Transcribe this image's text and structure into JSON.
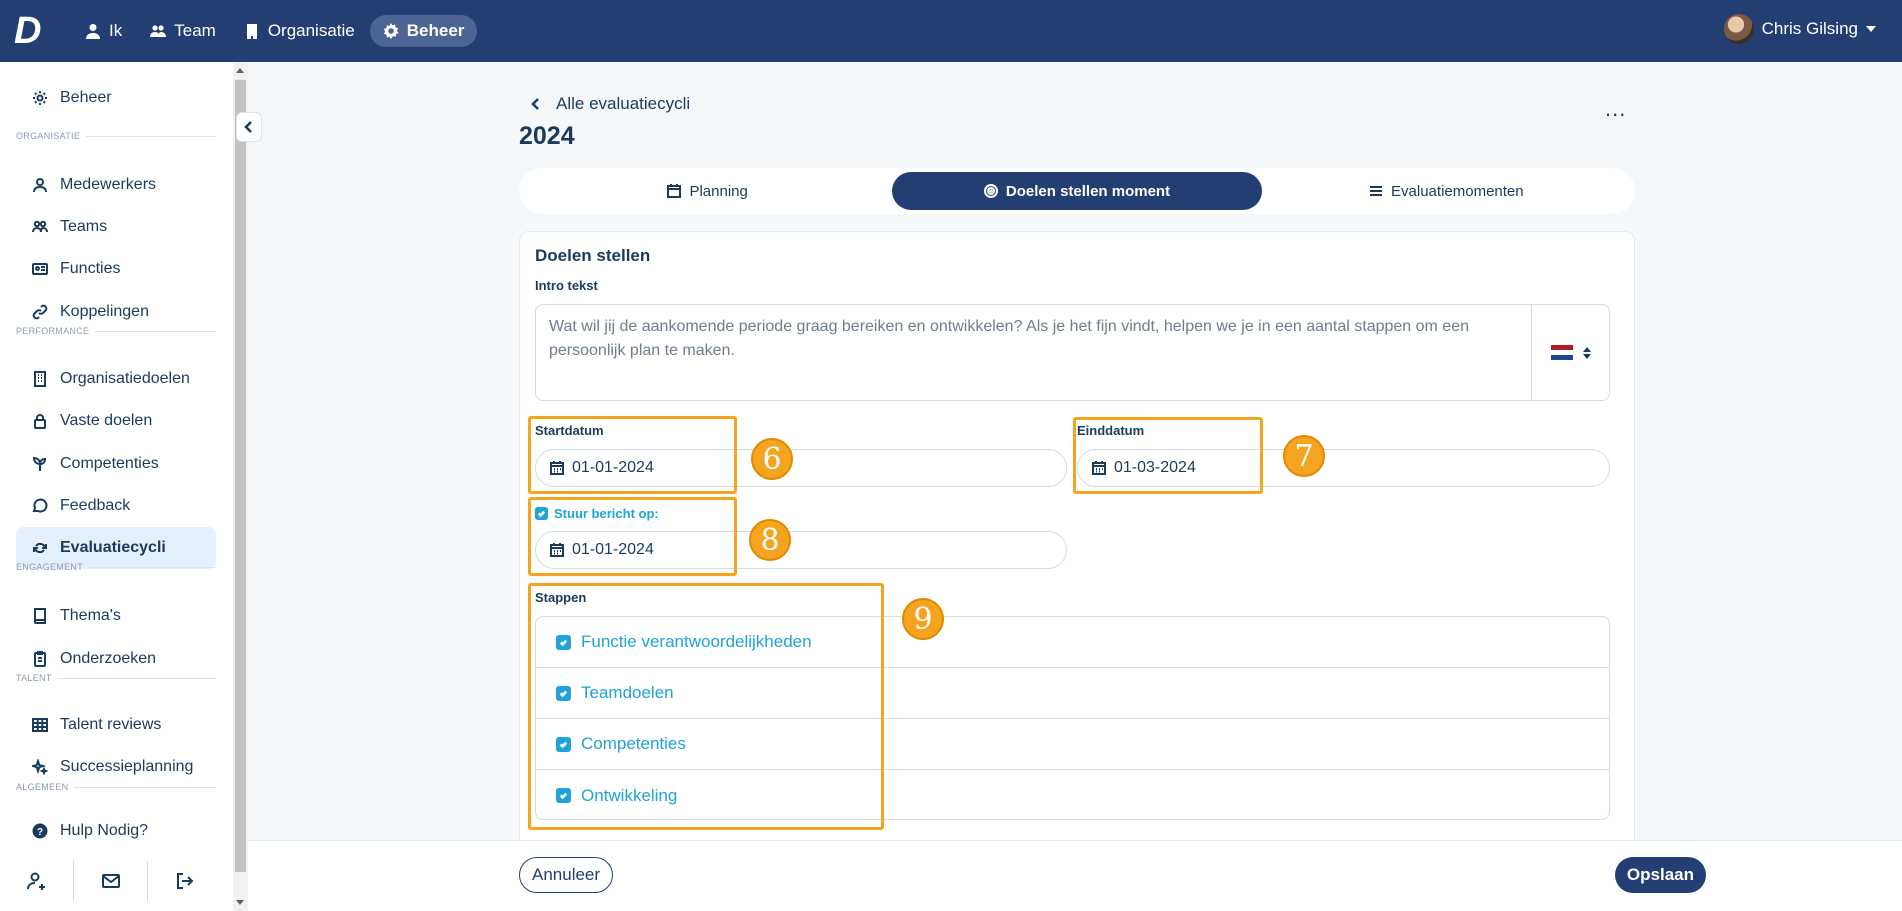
{
  "topbar": {
    "logo": "D",
    "nav": [
      {
        "label": "Ik",
        "icon": "user-icon"
      },
      {
        "label": "Team",
        "icon": "users-icon"
      },
      {
        "label": "Organisatie",
        "icon": "building-icon"
      },
      {
        "label": "Beheer",
        "icon": "gear-icon",
        "active": true
      }
    ],
    "user_name": "Chris Gilsing"
  },
  "sidebar": {
    "top": {
      "label": "Beheer",
      "icon": "gear-icon"
    },
    "sections": [
      {
        "title": "ORGANISATIE",
        "items": [
          "Medewerkers",
          "Teams",
          "Functies",
          "Koppelingen"
        ]
      },
      {
        "title": "PERFORMANCE",
        "items": [
          "Organisatiedoelen",
          "Vaste doelen",
          "Competenties",
          "Feedback",
          "Evaluatiecycli"
        ]
      },
      {
        "title": "ENGAGEMENT",
        "items": [
          "Thema's",
          "Onderzoeken"
        ]
      },
      {
        "title": "TALENT",
        "items": [
          "Talent reviews",
          "Successieplanning"
        ]
      },
      {
        "title": "ALGEMEEN",
        "items": []
      }
    ],
    "active_item": "Evaluatiecycli",
    "help": "Hulp Nodig?"
  },
  "page": {
    "back_label": "Alle evaluatiecycli",
    "title": "2024",
    "more": "...",
    "tabs": [
      {
        "label": "Planning",
        "icon": "calendar-icon"
      },
      {
        "label": "Doelen stellen moment",
        "icon": "target-icon",
        "active": true
      },
      {
        "label": "Evaluatiemomenten",
        "icon": "list-icon"
      }
    ]
  },
  "form": {
    "card_title": "Doelen stellen",
    "intro_label": "Intro tekst",
    "intro_text": "Wat wil jij de aankomende periode graag bereiken en ontwikkelen? Als je het fijn vindt, helpen we je in een aantal stappen om een persoonlijk plan te maken.",
    "language": "nl",
    "start_label": "Startdatum",
    "start_value": "01-01-2024",
    "end_label": "Einddatum",
    "end_value": "01-03-2024",
    "notify_label": "Stuur bericht op:",
    "notify_checked": true,
    "notify_value": "01-01-2024",
    "steps_label": "Stappen",
    "steps": [
      "Functie verantwoordelijkheden",
      "Teamdoelen",
      "Competenties",
      "Ontwikkeling"
    ]
  },
  "annotations": [
    "6",
    "7",
    "8",
    "9"
  ],
  "footer": {
    "cancel": "Annuleer",
    "save": "Opslaan"
  },
  "colors": {
    "primary": "#233e73",
    "accent": "#1fa3d8",
    "highlight": "#f5a41f"
  }
}
